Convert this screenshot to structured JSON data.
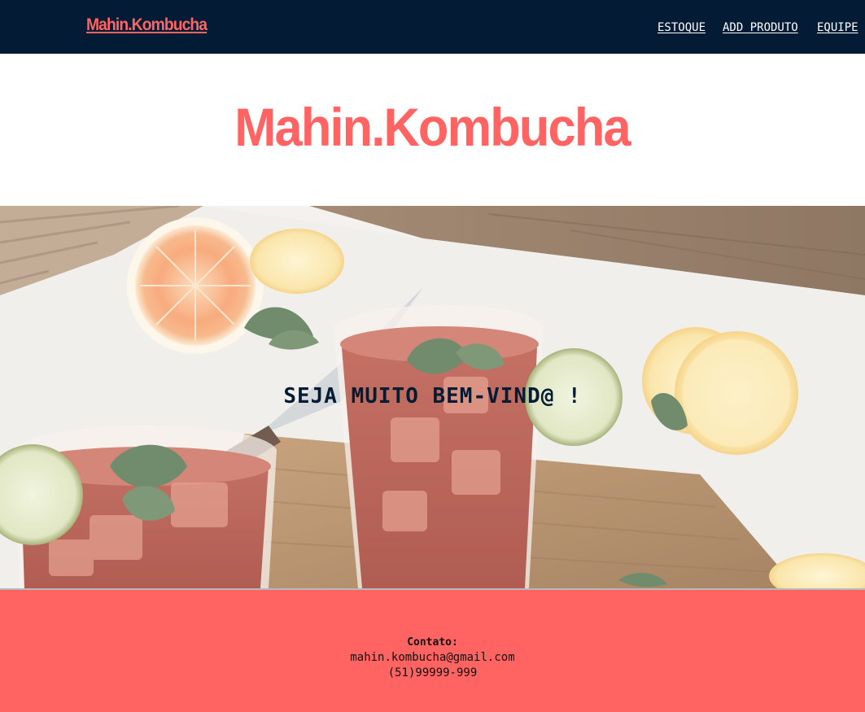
{
  "navbar": {
    "brand": "Mahin.Kombucha",
    "links": [
      "ESTOQUE",
      "ADD PRODUTO",
      "EQUIPE"
    ]
  },
  "hero": {
    "title": "Mahin.Kombucha"
  },
  "banner": {
    "welcome": "SEJA MUITO BEM-VIND@ !"
  },
  "footer": {
    "contact_heading": "Contato:",
    "email": "mahin.kombucha@gmail.com",
    "phone": "(51)99999-999"
  },
  "colors": {
    "navbar_bg": "#031b34",
    "accent": "#ff6362",
    "footer_bg": "#ff6362"
  }
}
